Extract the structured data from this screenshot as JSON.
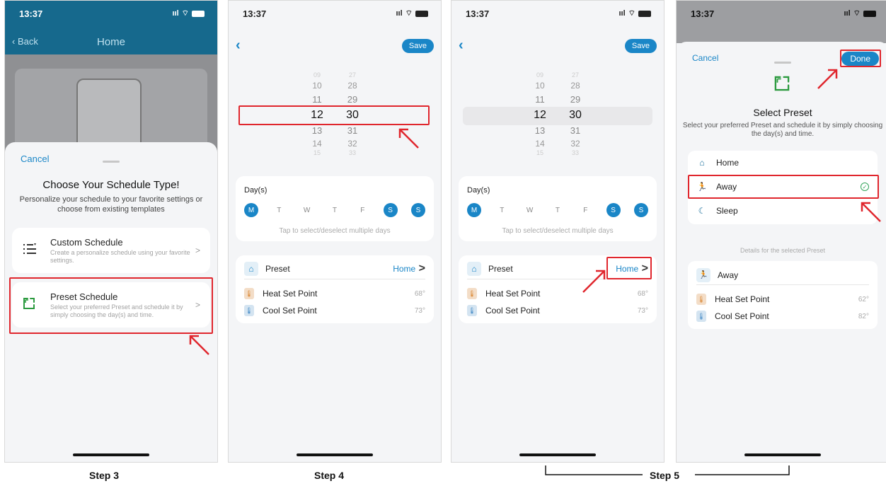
{
  "status": {
    "time": "13:37",
    "signal": "ııl"
  },
  "phone1": {
    "back_label": "Back",
    "title": "Home",
    "cancel": "Cancel",
    "sheet_title": "Choose Your Schedule Type!",
    "sheet_subtitle": "Personalize your schedule to your favorite settings or choose from existing templates",
    "options": [
      {
        "name": "Custom Schedule",
        "desc": "Create a personalize schedule using your favorite settings."
      },
      {
        "name": "Preset Schedule",
        "desc": "Select your preferred Preset and schedule it by simply choosing the day(s) and time."
      }
    ]
  },
  "schedule_screen": {
    "save": "Save",
    "picker": {
      "hours": [
        "09",
        "10",
        "11",
        "12",
        "13",
        "14",
        "15"
      ],
      "minutes": [
        "27",
        "28",
        "29",
        "30",
        "31",
        "32",
        "33"
      ],
      "selected_hour": "12",
      "selected_minute": "30"
    },
    "days_label": "Day(s)",
    "days": [
      {
        "letter": "M",
        "selected": true
      },
      {
        "letter": "T",
        "selected": false
      },
      {
        "letter": "W",
        "selected": false
      },
      {
        "letter": "T",
        "selected": false
      },
      {
        "letter": "F",
        "selected": false
      },
      {
        "letter": "S",
        "selected": true
      },
      {
        "letter": "S",
        "selected": true
      }
    ],
    "days_hint": "Tap to select/deselect multiple days",
    "preset_label": "Preset",
    "preset_value": "Home",
    "heat_label": "Heat Set Point",
    "heat_value": "68°",
    "cool_label": "Cool Set Point",
    "cool_value": "73°"
  },
  "phone4": {
    "cancel": "Cancel",
    "done": "Done",
    "title": "Select Preset",
    "subtitle": "Select your preferred Preset and schedule it by simply choosing the day(s) and time.",
    "presets": [
      {
        "name": "Home",
        "icon": "home-icon"
      },
      {
        "name": "Away",
        "icon": "runner-icon",
        "selected": true
      },
      {
        "name": "Sleep",
        "icon": "moon-icon"
      }
    ],
    "details_heading": "Details for the selected Preset",
    "detail_name": "Away",
    "heat_label": "Heat Set Point",
    "heat_value": "62°",
    "cool_label": "Cool Set Point",
    "cool_value": "82°"
  },
  "steps": {
    "step3": "Step 3",
    "step4": "Step 4",
    "step5": "Step 5"
  },
  "colors": {
    "accent": "#1a86c7",
    "header": "#16698d",
    "annotation": "#e0262d",
    "check": "#33a35a"
  }
}
